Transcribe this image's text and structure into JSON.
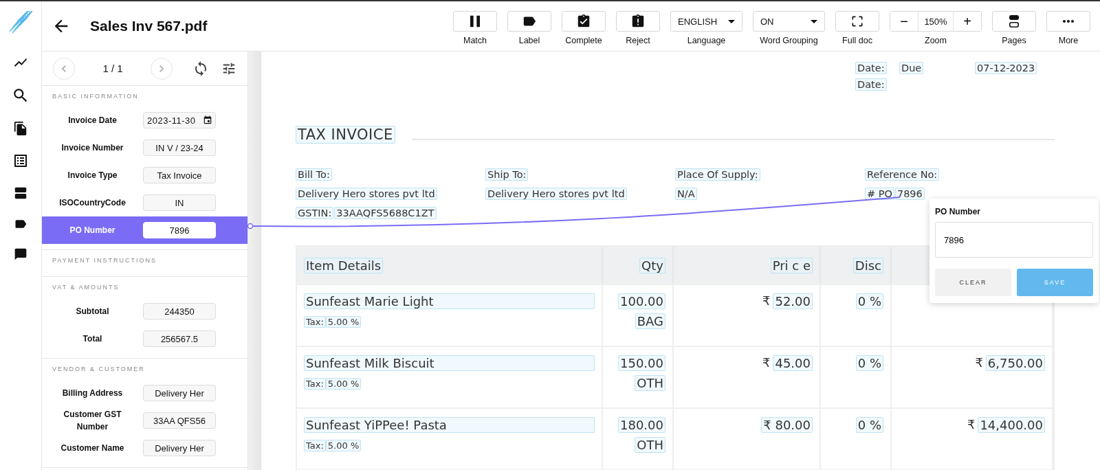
{
  "header": {
    "title": "Sales Inv 567.pdf"
  },
  "toolbar": [
    {
      "kind": "match",
      "label": "Match"
    },
    {
      "kind": "tag",
      "label": "Label"
    },
    {
      "kind": "complete",
      "label": "Complete"
    },
    {
      "kind": "reject",
      "label": "Reject"
    },
    {
      "kind": "select",
      "label": "Language",
      "value": "ENGLISH"
    },
    {
      "kind": "select",
      "label": "Word Grouping",
      "value": "ON"
    },
    {
      "kind": "fullscreen",
      "label": "Full doc"
    },
    {
      "kind": "zoom",
      "label": "Zoom",
      "value": "150%",
      "minus": "−",
      "plus": "+"
    },
    {
      "kind": "pages",
      "label": "Pages"
    },
    {
      "kind": "more",
      "label": "More"
    }
  ],
  "pager": {
    "text": "1 / 1"
  },
  "sections": [
    {
      "title": "BASIC INFORMATION",
      "fields": [
        {
          "label": "Invoice Date",
          "value": "2023-11-30",
          "kind": "date",
          "selected": false
        },
        {
          "label": "Invoice Number",
          "value": "IN V / 23-24",
          "kind": "text",
          "selected": false
        },
        {
          "label": "Invoice Type",
          "value": "Tax Invoice",
          "kind": "text",
          "selected": false
        },
        {
          "label": "ISOCountryCode",
          "value": "IN",
          "kind": "text",
          "selected": false
        },
        {
          "label": "PO Number",
          "value": "7896",
          "kind": "text",
          "selected": true
        }
      ]
    },
    {
      "title": "PAYMENT INSTRUCTIONS"
    },
    {
      "title": "VAT & AMOUNTS",
      "fields": [
        {
          "label": "Subtotal",
          "value": "244350",
          "kind": "text",
          "selected": false
        },
        {
          "label": "Total",
          "value": "256567.5",
          "kind": "text",
          "selected": false
        }
      ]
    },
    {
      "title": "VENDOR & CUSTOMER",
      "fields": [
        {
          "label": "Billing Address",
          "value": "Delivery Her",
          "kind": "text",
          "selected": false
        },
        {
          "label": "Customer GST Number",
          "value": "33AA QFS56",
          "kind": "text",
          "selected": false
        },
        {
          "label": "Customer Name",
          "value": "Delivery Her",
          "kind": "text",
          "selected": false
        }
      ]
    }
  ],
  "document": {
    "dates": [
      [
        "Date:",
        "Due",
        "07-12-2023"
      ],
      [
        "Date:"
      ]
    ],
    "title": "TAX INVOICE",
    "parties": [
      {
        "heading": "Bill To:",
        "lines": [
          [
            "Delivery Hero stores pvt ltd"
          ],
          [
            "GSTIN:",
            "33AAQFS5688C1ZT"
          ]
        ]
      },
      {
        "heading": "Ship To:",
        "lines": [
          [
            "Delivery Hero stores pvt ltd"
          ]
        ]
      },
      {
        "heading": "Place Of Supply:",
        "lines": [
          [
            "N/A"
          ]
        ]
      },
      {
        "heading": "Reference No:",
        "lines": [
          [
            "# PO",
            "7896"
          ]
        ]
      }
    ],
    "table": {
      "columns": [
        "Item Details",
        "Qty",
        "Pri c e",
        "Disc"
      ],
      "rows": [
        {
          "item": "Sunfeast Marie Light",
          "tax_label": "Tax:",
          "tax": "5.00 %",
          "qty": "100.00",
          "unit": "BAG",
          "currency": "₹",
          "price": "52.00",
          "disc": "0 %"
        },
        {
          "item": "Sunfeast Milk Biscuit",
          "tax_label": "Tax:",
          "tax": "5.00 %",
          "qty": "150.00",
          "unit": "OTH",
          "currency": "₹",
          "price": "45.00",
          "disc": "0 %",
          "amount_currency": "₹",
          "amount": "6,750.00"
        },
        {
          "item": "Sunfeast YiPPee! Pasta",
          "tax_label": "Tax:",
          "tax": "5.00 %",
          "qty": "180.00",
          "unit": "OTH",
          "price": "₹ 80.00",
          "disc": "0 %",
          "amount_currency": "₹",
          "amount": "14,400.00"
        }
      ]
    }
  },
  "popup": {
    "title": "PO Number",
    "value": "7896",
    "clear": "CLEAR",
    "save": "SAVE"
  }
}
